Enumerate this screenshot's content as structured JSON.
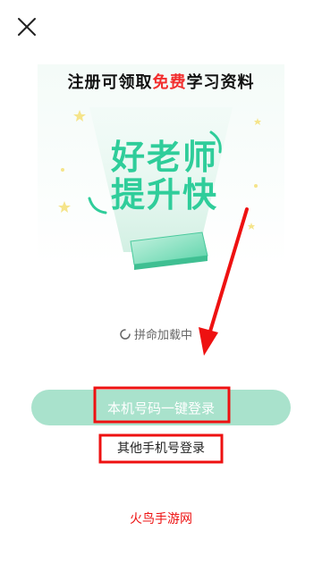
{
  "header": {
    "close_icon": "close-icon"
  },
  "banner": {
    "title_prefix": "注册可领取",
    "title_highlight": "免费",
    "title_suffix": "学习资料",
    "slogan_line1": "好老师",
    "slogan_line2": "提升快"
  },
  "loading": {
    "text": "拼命加载中"
  },
  "actions": {
    "one_click_login": "本机号码一键登录",
    "other_phone_login": "其他手机号登录"
  },
  "watermark": {
    "text": "火鸟手游网"
  },
  "colors": {
    "accent": "#2fcd9a",
    "button_bg": "#a9e2cc",
    "highlight": "#f22e2e",
    "annotation": "#e11"
  }
}
